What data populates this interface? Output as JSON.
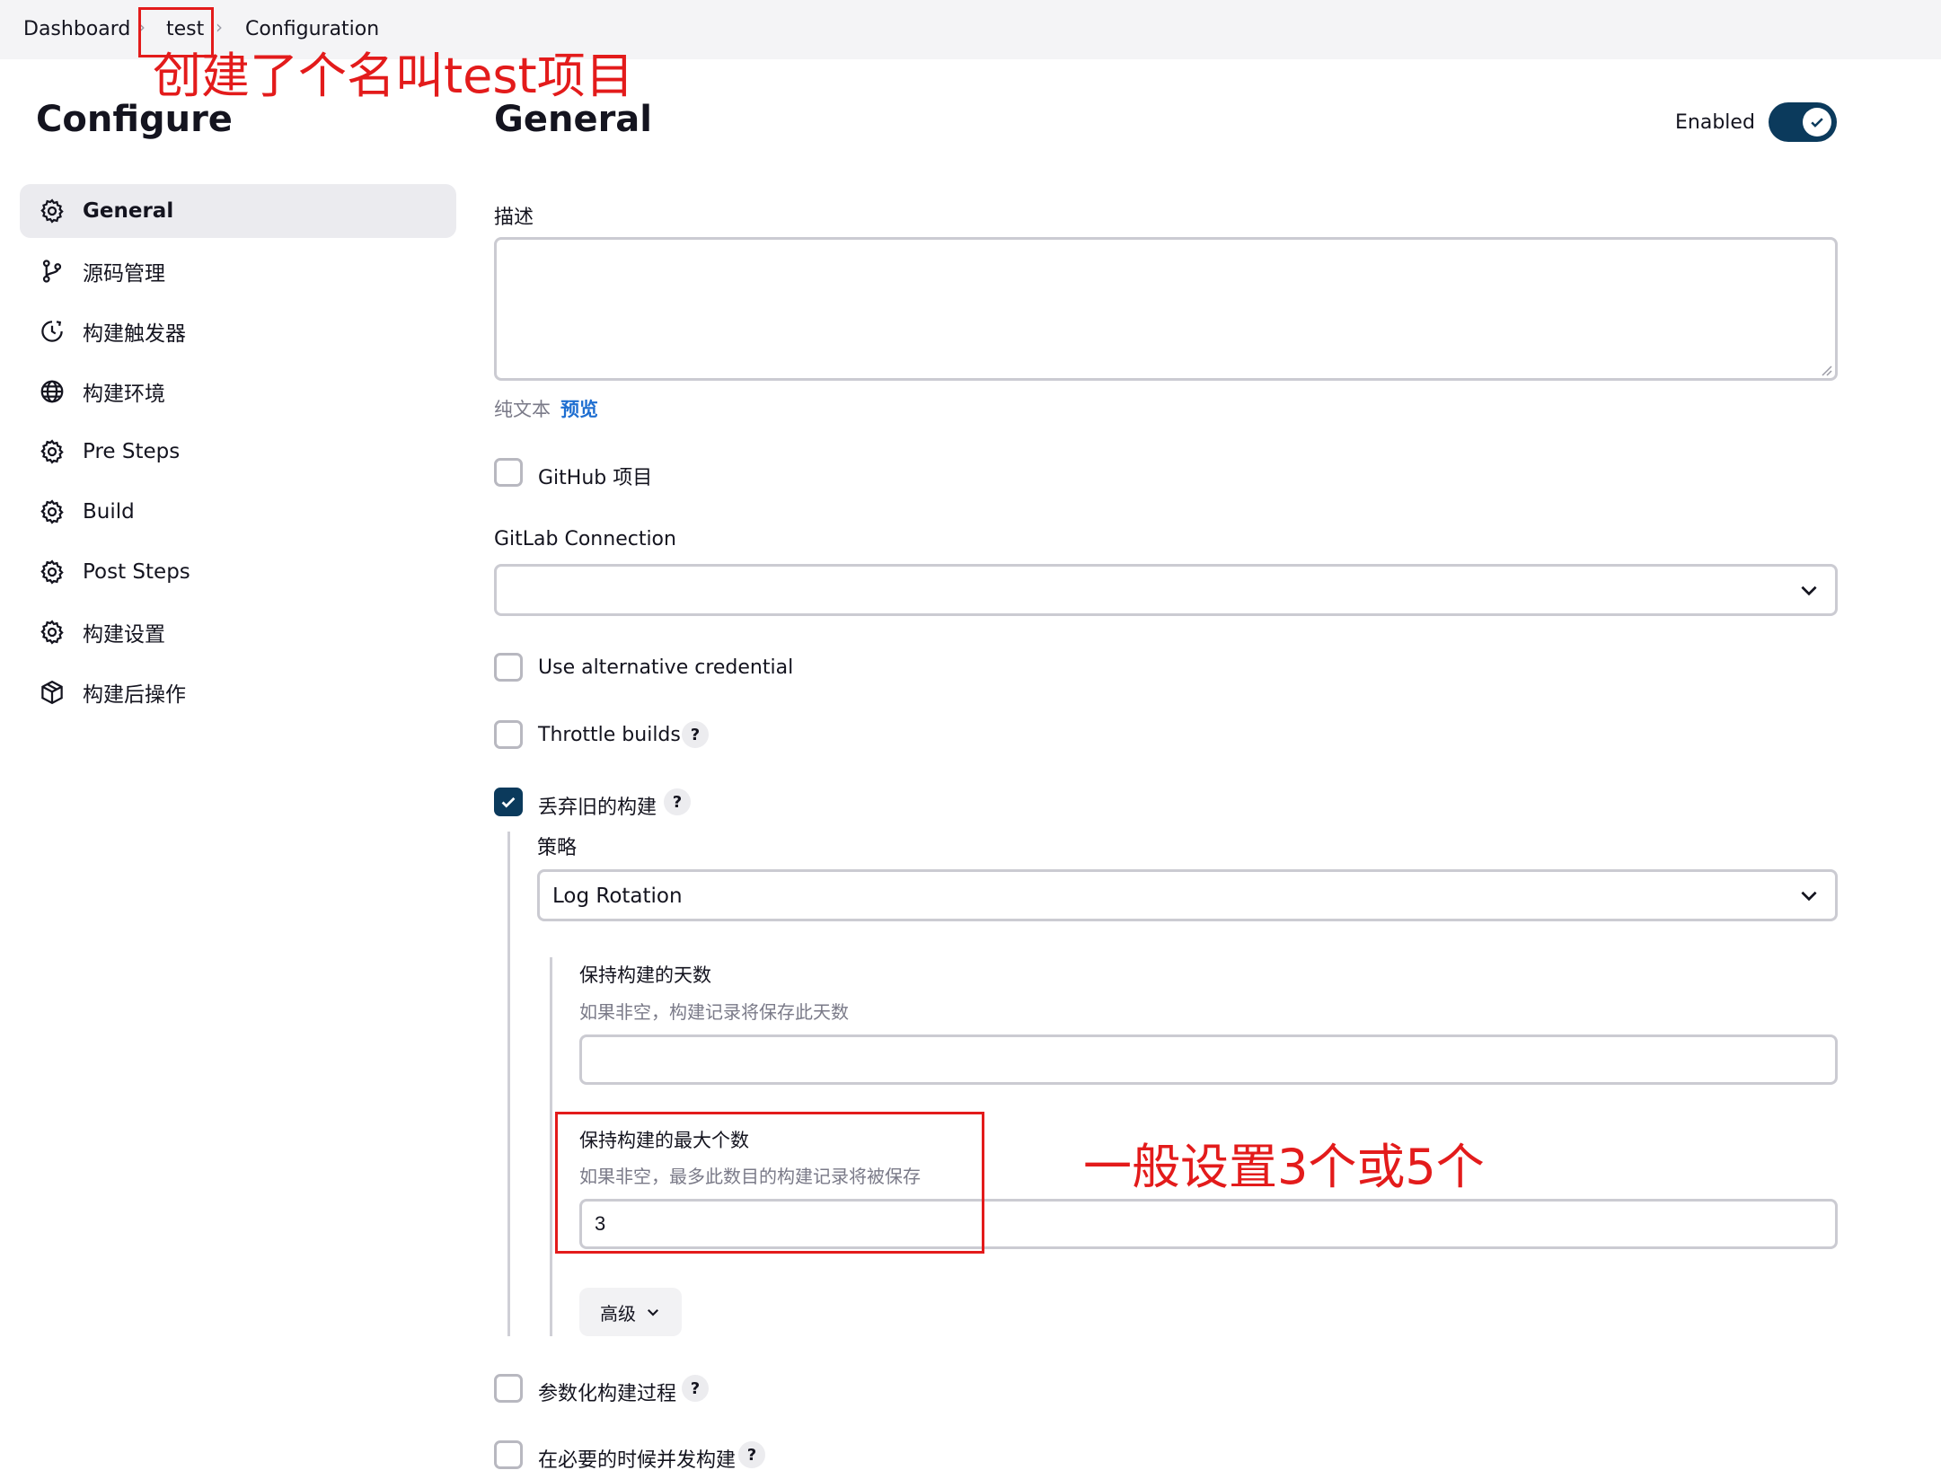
{
  "breadcrumb": {
    "items": [
      "Dashboard",
      "test",
      "Configuration"
    ]
  },
  "annotations": {
    "top_note": "创建了个名叫test项目",
    "side_note": "一般设置3个或5个"
  },
  "sidebar": {
    "title": "Configure",
    "items": [
      {
        "label": "General",
        "icon": "gear-icon"
      },
      {
        "label": "源码管理",
        "icon": "branch-icon"
      },
      {
        "label": "构建触发器",
        "icon": "clock-icon"
      },
      {
        "label": "构建环境",
        "icon": "globe-icon"
      },
      {
        "label": "Pre Steps",
        "icon": "gear-icon"
      },
      {
        "label": "Build",
        "icon": "gear-icon"
      },
      {
        "label": "Post Steps",
        "icon": "gear-icon"
      },
      {
        "label": "构建设置",
        "icon": "gear-icon"
      },
      {
        "label": "构建后操作",
        "icon": "package-icon"
      }
    ]
  },
  "main": {
    "title": "General",
    "enabled_label": "Enabled",
    "enabled": true,
    "description_label": "描述",
    "description_value": "",
    "format_plain": "纯文本",
    "format_preview": "预览",
    "github_project": "GitHub 项目",
    "gitlab_connection_label": "GitLab Connection",
    "gitlab_connection_value": "",
    "use_alt_credential": "Use alternative credential",
    "throttle_builds": "Throttle builds",
    "discard_old_builds": "丢弃旧的构建",
    "strategy_label": "策略",
    "strategy_value": "Log Rotation",
    "days_label": "保持构建的天数",
    "days_hint": "如果非空，构建记录将保存此天数",
    "days_value": "",
    "max_label": "保持构建的最大个数",
    "max_hint": "如果非空，最多此数目的构建记录将被保存",
    "max_value": "3",
    "advanced": "高级",
    "parameterized": "参数化构建过程",
    "concurrent": "在必要的时候并发构建",
    "help_glyph": "?"
  },
  "colors": {
    "accent": "#0b3a5c",
    "annotation": "#e31b1b"
  }
}
